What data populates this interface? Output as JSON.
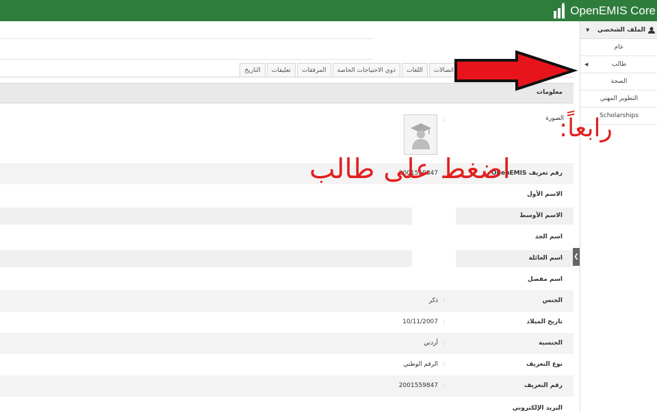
{
  "topbar": {
    "brand": "OpenEMIS Core",
    "color": "#2e7d3d"
  },
  "tabs": [
    "اتصالات",
    "اللغات",
    "ذوي الاحتياجات الخاصة",
    "المرفقات",
    "تعليقات",
    "التاريخ"
  ],
  "section": {
    "title": "معلومات"
  },
  "photo": {
    "label": "الصورة",
    "colon": ":",
    "icon": "graduate-avatar-icon"
  },
  "rows": [
    {
      "label": "رقم تعريف OpenEMIS",
      "value": "2001559847"
    },
    {
      "label": "الاسم الأول",
      "value": ""
    },
    {
      "label": "الاسم الأوسط",
      "value": ""
    },
    {
      "label": "اسم الجد",
      "value": ""
    },
    {
      "label": "اسم العائلة",
      "value": ""
    },
    {
      "label": "اسم مفضل",
      "value": ""
    },
    {
      "label": "الجنس",
      "value": "ذكر"
    },
    {
      "label": "تاريخ الميلاد",
      "value": "10/11/2007"
    },
    {
      "label": "الجنسية",
      "value": "أردني"
    },
    {
      "label": "نوع التعريف",
      "value": "الرقم الوطني"
    },
    {
      "label": "رقم التعريف",
      "value": "2001559847"
    },
    {
      "label": "البريد الإلكتروني",
      "value": ""
    }
  ],
  "sidebar": {
    "profile_label": "الملف الشخصي",
    "items": [
      {
        "label": "عام"
      },
      {
        "label": "طالب"
      },
      {
        "label": "الصحة"
      },
      {
        "label": "التطوير المهني"
      },
      {
        "label": "Scholarships"
      }
    ]
  },
  "annotation": {
    "step": "رابعاً:",
    "instruction": "اضغط على طالب",
    "color": "#e02020"
  }
}
